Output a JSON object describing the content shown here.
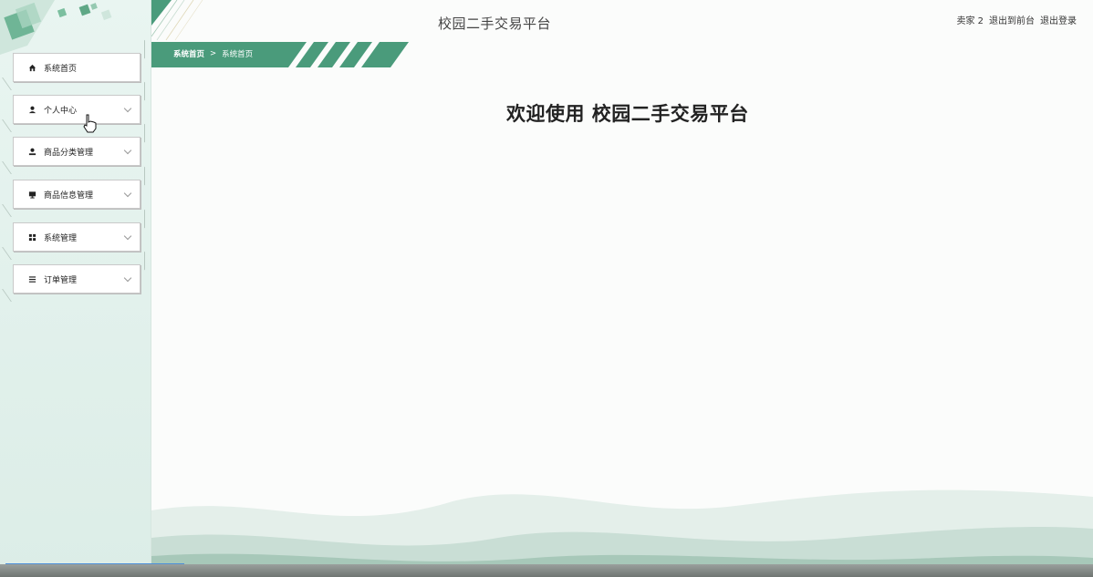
{
  "app": {
    "title": "校园二手交易平台",
    "welcome": "欢迎使用 校园二手交易平台",
    "accent_color": "#4a9b7b"
  },
  "header": {
    "user": "卖家 2",
    "back_to_front": "退出到前台",
    "logout": "退出登录"
  },
  "breadcrumb": {
    "home": "系统首页",
    "separator": ">",
    "current": "系统首页"
  },
  "sidebar": {
    "items": [
      {
        "label": "系统首页",
        "icon": "home-icon",
        "expandable": false
      },
      {
        "label": "个人中心",
        "icon": "user-icon",
        "expandable": true
      },
      {
        "label": "商品分类管理",
        "icon": "user-icon",
        "expandable": true
      },
      {
        "label": "商品信息管理",
        "icon": "monitor-icon",
        "expandable": true
      },
      {
        "label": "系统管理",
        "icon": "grid-icon",
        "expandable": true
      },
      {
        "label": "订单管理",
        "icon": "list-icon",
        "expandable": true
      }
    ]
  }
}
